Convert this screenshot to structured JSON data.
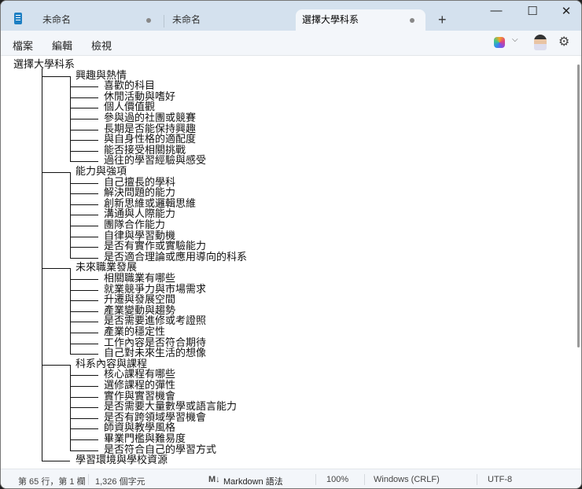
{
  "tabs": [
    {
      "label": "未命名",
      "unsaved": true
    },
    {
      "label": "未命名",
      "unsaved": false
    },
    {
      "label": "選擇大學科系",
      "unsaved": true,
      "active": true
    }
  ],
  "menu": {
    "file": "檔案",
    "edit": "編輯",
    "view": "檢視"
  },
  "document": {
    "root": "選擇大學科系",
    "groups": [
      {
        "label": "興趣與熱情",
        "items": [
          "喜歡的科目",
          "休閒活動與嗜好",
          "個人價值觀",
          "參與過的社團或競賽",
          "長期是否能保持興趣",
          "與自身性格的適配度",
          "能否接受相關挑戰",
          "過往的學習經驗與感受"
        ]
      },
      {
        "label": "能力與強項",
        "items": [
          "自己擅長的學科",
          "解決問題的能力",
          "創新思維或邏輯思維",
          "溝通與人際能力",
          "團隊合作能力",
          "自律與學習動機",
          "是否有實作或實驗能力",
          "是否適合理論或應用導向的科系"
        ]
      },
      {
        "label": "未來職業發展",
        "items": [
          "相關職業有哪些",
          "就業競爭力與市場需求",
          "升遷與發展空間",
          "產業變動與趨勢",
          "是否需要進修或考證照",
          "產業的穩定性",
          "工作內容是否符合期待",
          "自己對未來生活的想像"
        ]
      },
      {
        "label": "科系內容與課程",
        "items": [
          "核心課程有哪些",
          "選修課程的彈性",
          "實作與實習機會",
          "是否需要大量數學或語言能力",
          "是否有跨領域學習機會",
          "師資與教學風格",
          "畢業門檻與難易度",
          "是否符合自己的學習方式"
        ]
      },
      {
        "label": "學習環境與學校資源",
        "items": []
      }
    ]
  },
  "status": {
    "position": "第 65 行，第 1 欄",
    "chars": "1,326 個字元",
    "syntax": "Markdown 語法",
    "syntax_icon": "M↓",
    "zoom": "100%",
    "line_ending": "Windows (CRLF)",
    "encoding": "UTF-8"
  }
}
